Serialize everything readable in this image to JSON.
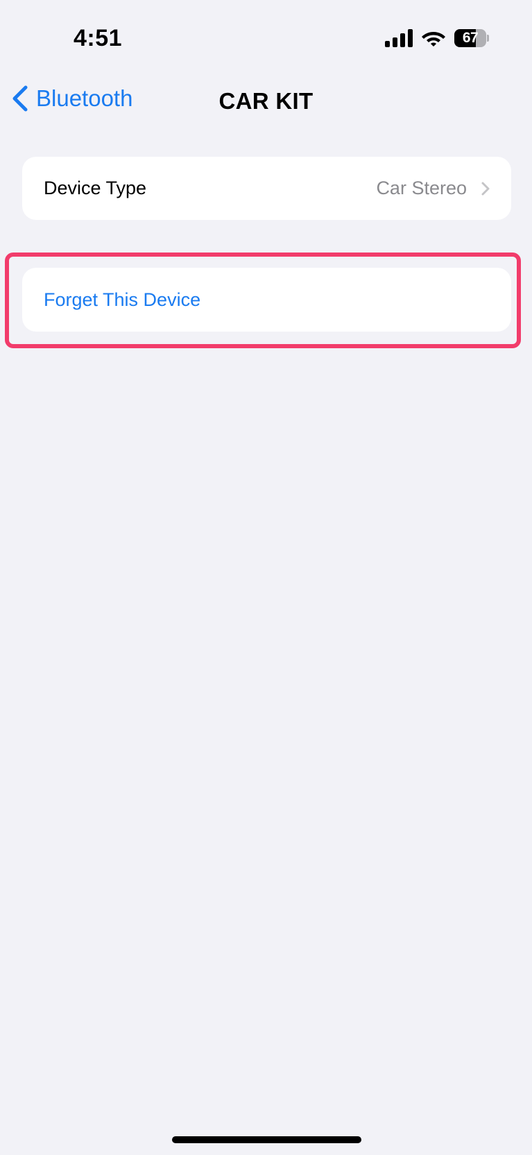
{
  "status_bar": {
    "time": "4:51",
    "battery_level": "67",
    "battery_percent": 67,
    "icons": [
      "signal-icon",
      "wifi-icon",
      "battery-icon"
    ]
  },
  "nav": {
    "back_label": "Bluetooth",
    "title": "CAR KIT"
  },
  "settings": {
    "device_type": {
      "label": "Device Type",
      "value": "Car Stereo"
    },
    "forget": {
      "label": "Forget This Device"
    }
  },
  "colors": {
    "accent": "#1a7bf0",
    "background": "#f2f2f7",
    "highlight": "#f23c6b",
    "secondary_text": "#8a8a8e"
  }
}
